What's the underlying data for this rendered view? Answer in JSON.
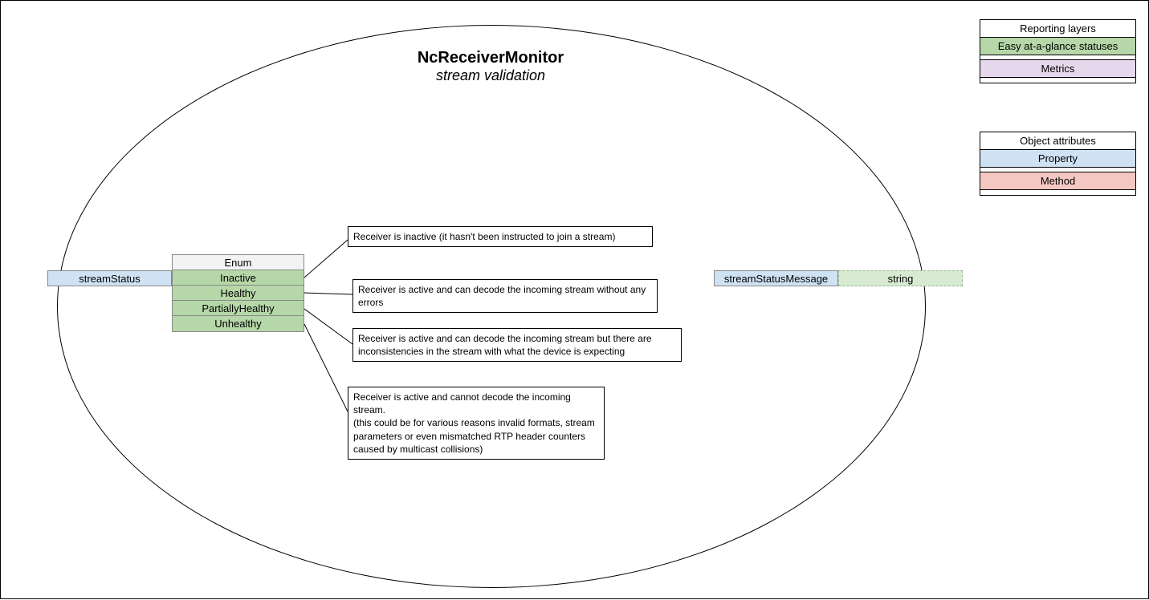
{
  "title": {
    "main": "NcReceiverMonitor",
    "sub": "stream validation"
  },
  "props": {
    "streamStatus": "streamStatus",
    "streamStatusMessage": "streamStatusMessage"
  },
  "enum": {
    "header": "Enum",
    "values": [
      "Inactive",
      "Healthy",
      "PartiallyHealthy",
      "Unhealthy"
    ]
  },
  "typeBox": "string",
  "notes": {
    "inactive": "Receiver is inactive (it hasn't been instructed to join a stream)",
    "healthy": " Receiver is active and can decode the incoming stream without any errors",
    "partial": " Receiver is active and can decode the incoming stream but there are inconsistencies in the stream with what the device is expecting",
    "unhealthy": " Receiver is active and cannot decode the incoming stream.\n(this could be for various reasons invalid formats, stream parameters or even mismatched RTP header counters caused by multicast collisions)"
  },
  "legend1": {
    "title": "Reporting layers",
    "rows": [
      "Easy at-a-glance statuses",
      "Metrics"
    ]
  },
  "legend2": {
    "title": "Object attributes",
    "rows": [
      "Property",
      "Method"
    ]
  }
}
